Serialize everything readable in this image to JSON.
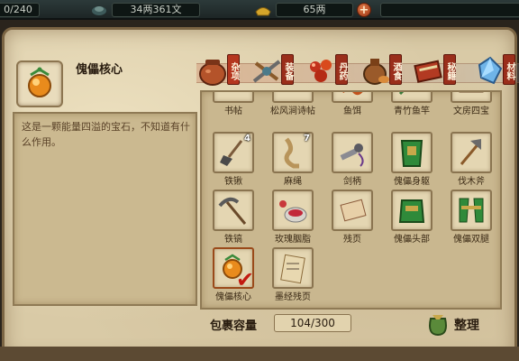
{
  "topbar": {
    "stamina": "0/240",
    "copper": "34两361文",
    "silver": "65两",
    "plus_label": "+"
  },
  "selected_item": {
    "name": "傀儡核心",
    "description": "这是一颗能量四溢的宝石，不知道有什么作用。",
    "icon": "orange-gem-icon"
  },
  "tabs": [
    {
      "label": "杂项",
      "icon": "pot-icon",
      "active": true
    },
    {
      "label": "装备",
      "icon": "sword-bundle-icon",
      "active": false
    },
    {
      "label": "丹药",
      "icon": "pills-icon",
      "active": false
    },
    {
      "label": "酒食",
      "icon": "wine-jar-icon",
      "active": false
    },
    {
      "label": "秘籍",
      "icon": "book-icon",
      "active": false
    },
    {
      "label": "材料",
      "icon": "crystal-icon",
      "active": false
    }
  ],
  "inventory": {
    "rows": [
      [
        {
          "name": "书帖",
          "icon": "scroll-icon",
          "count": ""
        },
        {
          "name": "松风涧诗帖",
          "icon": "poem-scroll-icon",
          "count": ""
        },
        {
          "name": "鱼饵",
          "icon": "worm-icon",
          "count": ""
        },
        {
          "name": "青竹鱼竿",
          "icon": "fishing-rod-icon",
          "count": ""
        },
        {
          "name": "文房四宝",
          "icon": "brush-set-icon",
          "count": ""
        }
      ],
      [
        {
          "name": "铁锹",
          "icon": "shovel-icon",
          "count": "4"
        },
        {
          "name": "麻绳",
          "icon": "rope-icon",
          "count": "7"
        },
        {
          "name": "剑柄",
          "icon": "sword-hilt-icon",
          "count": ""
        },
        {
          "name": "傀儡身躯",
          "icon": "puppet-torso-icon",
          "count": ""
        },
        {
          "name": "伐木斧",
          "icon": "axe-icon",
          "count": ""
        }
      ],
      [
        {
          "name": "铁镐",
          "icon": "pickaxe-icon",
          "count": ""
        },
        {
          "name": "玫瑰胭脂",
          "icon": "rouge-icon",
          "count": ""
        },
        {
          "name": "残页",
          "icon": "torn-page-icon",
          "count": ""
        },
        {
          "name": "傀儡头部",
          "icon": "puppet-head-icon",
          "count": ""
        },
        {
          "name": "傀儡双腿",
          "icon": "puppet-legs-icon",
          "count": ""
        }
      ],
      [
        {
          "name": "傀儡核心",
          "icon": "orange-gem-icon",
          "count": "",
          "selected": true
        },
        {
          "name": "墨经残页",
          "icon": "ink-page-icon",
          "count": ""
        }
      ]
    ],
    "selected_mark": "✔"
  },
  "capacity": {
    "label": "包裹容量",
    "value": "104/300"
  },
  "sort_button": {
    "label": "整理",
    "icon": "money-bag-icon"
  },
  "colors": {
    "parchment": "#d9caa6",
    "tab_red": "#b5361f",
    "frame_brown": "#8a7450"
  }
}
